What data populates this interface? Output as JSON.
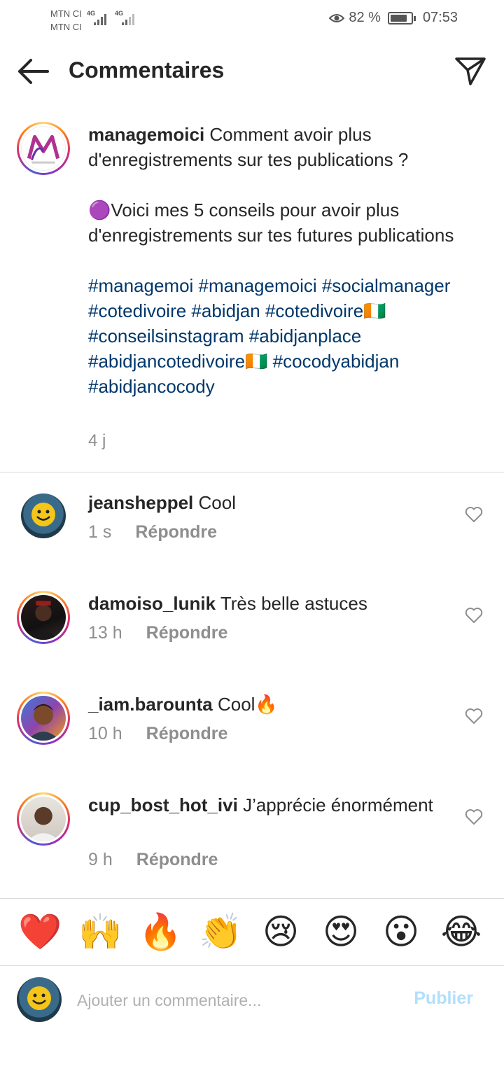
{
  "status_bar": {
    "carrier_1": "MTN CI",
    "carrier_2": "MTN CI",
    "network_1": "4G",
    "network_2": "4G",
    "battery_percent": "82 %",
    "battery_level": 0.82,
    "time": "07:53"
  },
  "header": {
    "title": "Commentaires"
  },
  "caption": {
    "username": "managemoici",
    "line1": "Comment avoir plus d'enregistrements sur tes publications ?",
    "line2": "🟣Voici mes 5 conseils pour avoir plus d'enregistrements sur tes futures publications",
    "hashtags": "#managemoi #managemoici #socialmanager #cotedivoire #abidjan #cotedivoire🇨🇮 #conseilsinstagram #abidjanplace #abidjancotedivoire🇨🇮 #cocodyabidjan #abidjancocody",
    "time": "4 j"
  },
  "comments": [
    {
      "username": "jeansheppel",
      "text": "Cool",
      "time": "1 s",
      "reply": "Répondre"
    },
    {
      "username": "damoiso_lunik",
      "text": "Très belle astuces",
      "time": "13 h",
      "reply": "Répondre"
    },
    {
      "username": "_iam.barounta",
      "text": "Cool🔥",
      "time": "10 h",
      "reply": "Répondre"
    },
    {
      "username": "cup_bost_hot_ivi",
      "text": "J’apprécie énormément",
      "time": "9 h",
      "reply": "Répondre"
    }
  ],
  "emoji_bar": [
    "❤️",
    "🙌",
    "🔥",
    "👏",
    "😢",
    "😍",
    "😮",
    "😂"
  ],
  "composer": {
    "placeholder": "Ajouter un commentaire...",
    "publish_label": "Publier"
  },
  "colors": {
    "hashtag": "#00376b",
    "muted": "#8e8e8e",
    "publish_disabled": "#b2dffc"
  }
}
